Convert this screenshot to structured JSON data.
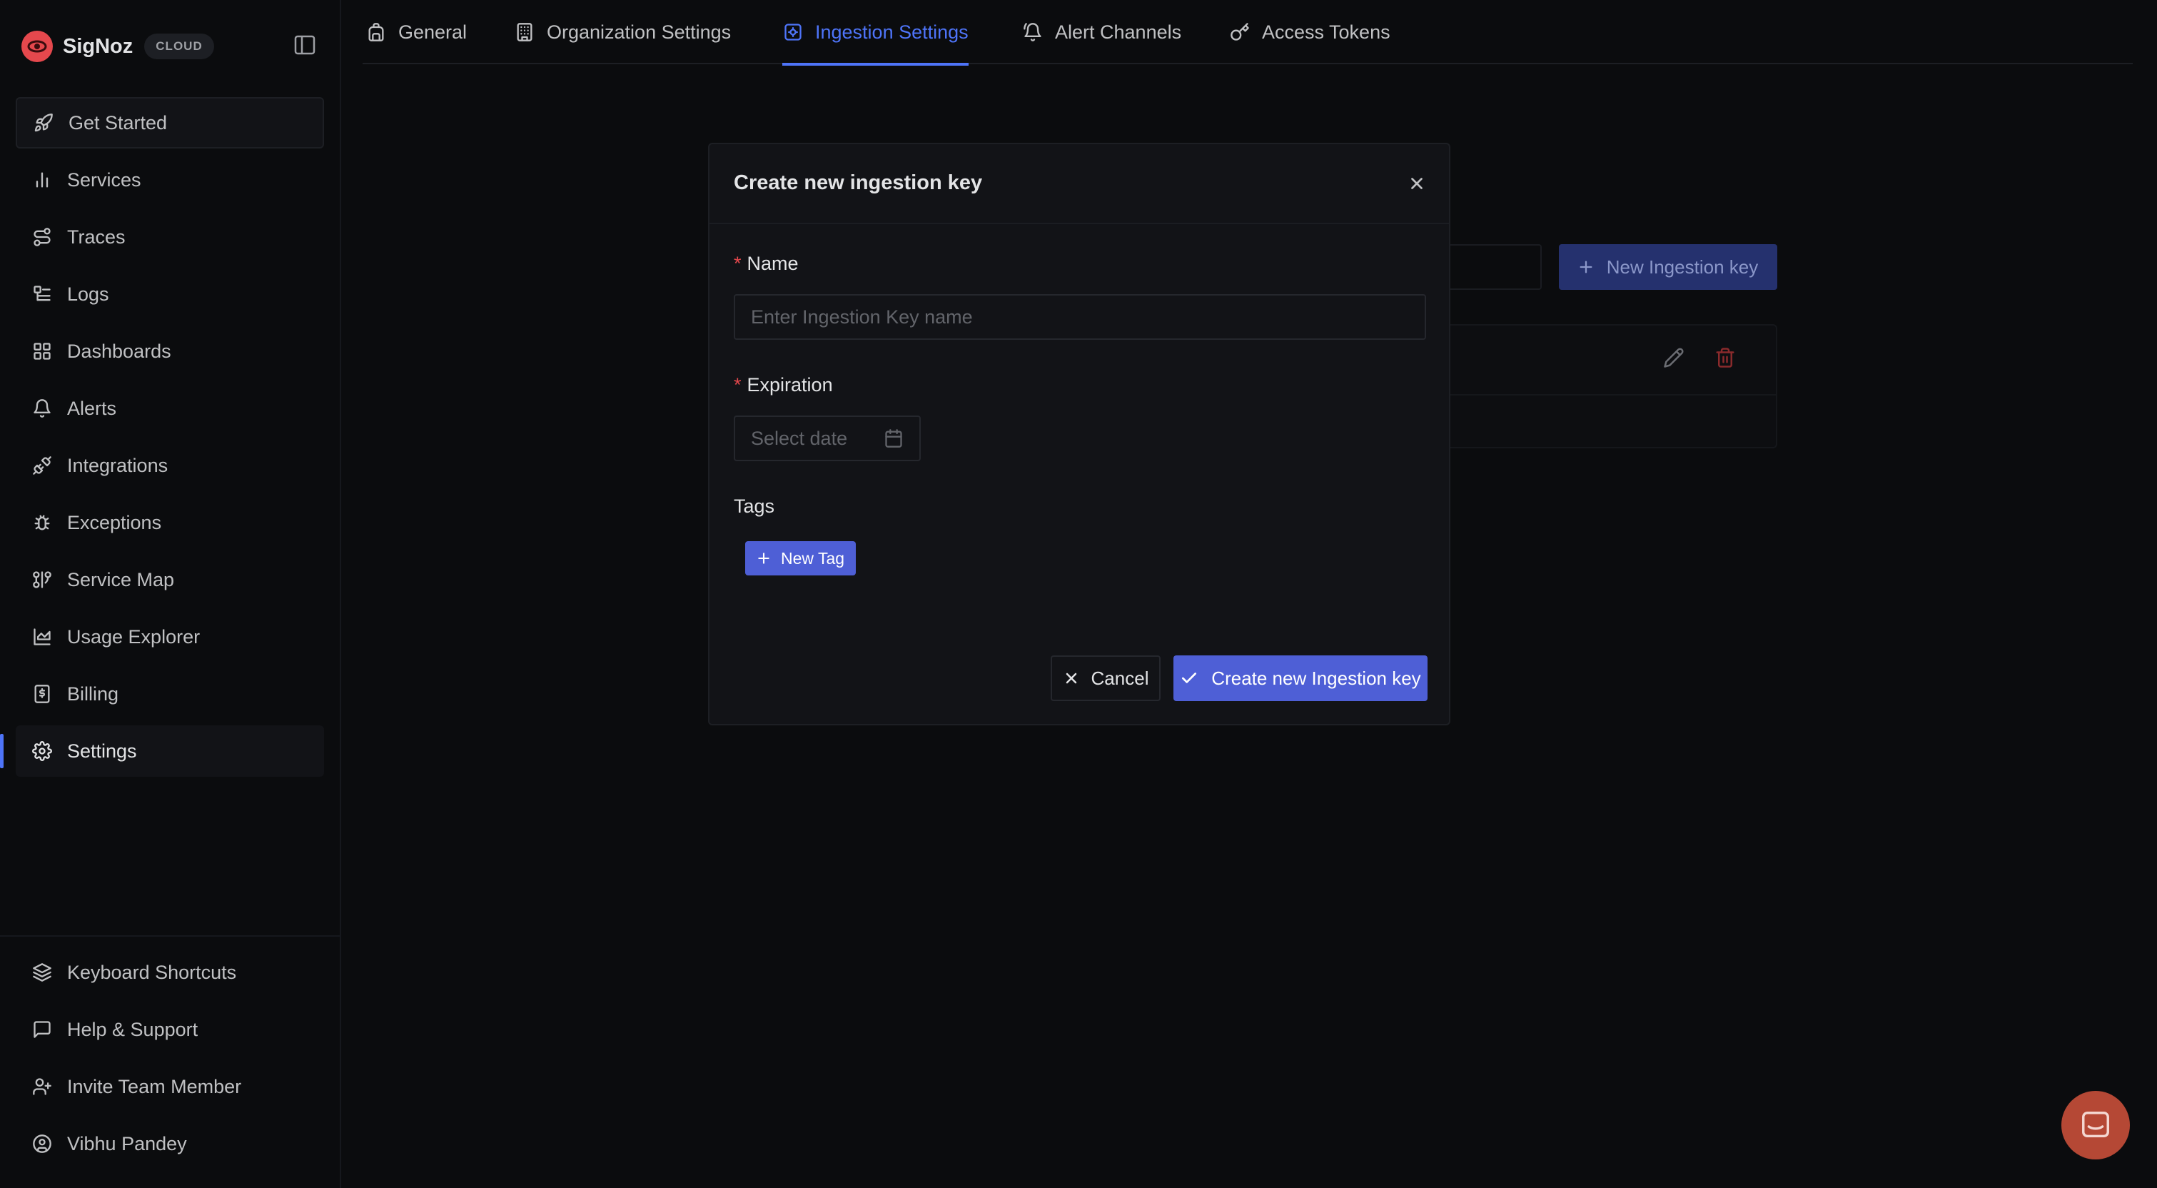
{
  "brand": {
    "name": "SigNoz",
    "badge": "CLOUD"
  },
  "sidebar": {
    "items": [
      {
        "label": "Get Started",
        "icon": "rocket-icon"
      },
      {
        "label": "Services",
        "icon": "bar-chart-icon"
      },
      {
        "label": "Traces",
        "icon": "route-icon"
      },
      {
        "label": "Logs",
        "icon": "logs-icon"
      },
      {
        "label": "Dashboards",
        "icon": "dashboard-grid-icon"
      },
      {
        "label": "Alerts",
        "icon": "bell-icon"
      },
      {
        "label": "Integrations",
        "icon": "plug-icon"
      },
      {
        "label": "Exceptions",
        "icon": "bug-icon"
      },
      {
        "label": "Service Map",
        "icon": "route-map-icon"
      },
      {
        "label": "Usage Explorer",
        "icon": "area-chart-icon"
      },
      {
        "label": "Billing",
        "icon": "receipt-icon"
      },
      {
        "label": "Settings",
        "icon": "gear-icon"
      }
    ],
    "bottom_items": [
      {
        "label": "Keyboard Shortcuts",
        "icon": "layers-icon"
      },
      {
        "label": "Help & Support",
        "icon": "message-square-icon"
      },
      {
        "label": "Invite Team Member",
        "icon": "user-plus-icon"
      },
      {
        "label": "Vibhu Pandey",
        "icon": "user-circle-icon"
      }
    ]
  },
  "tabs": [
    {
      "label": "General",
      "icon": "backpack-icon"
    },
    {
      "label": "Organization Settings",
      "icon": "building-icon"
    },
    {
      "label": "Ingestion Settings",
      "icon": "cog-square-icon",
      "active": true
    },
    {
      "label": "Alert Channels",
      "icon": "bell-ring-icon"
    },
    {
      "label": "Access Tokens",
      "icon": "key-icon"
    }
  ],
  "background": {
    "new_key_label": "New Ingestion key"
  },
  "modal": {
    "title": "Create new ingestion key",
    "name_label": "Name",
    "name_placeholder": "Enter Ingestion Key name",
    "name_value": "",
    "expiration_label": "Expiration",
    "expiration_placeholder": "Select date",
    "tags_label": "Tags",
    "new_tag_label": "New Tag",
    "cancel_label": "Cancel",
    "create_label": "Create new Ingestion key"
  },
  "colors": {
    "accent": "#4e74f8",
    "primary_button": "#4e5fd6",
    "danger": "#e5484d",
    "background": "#0b0c0e",
    "modal_background": "#121317"
  }
}
